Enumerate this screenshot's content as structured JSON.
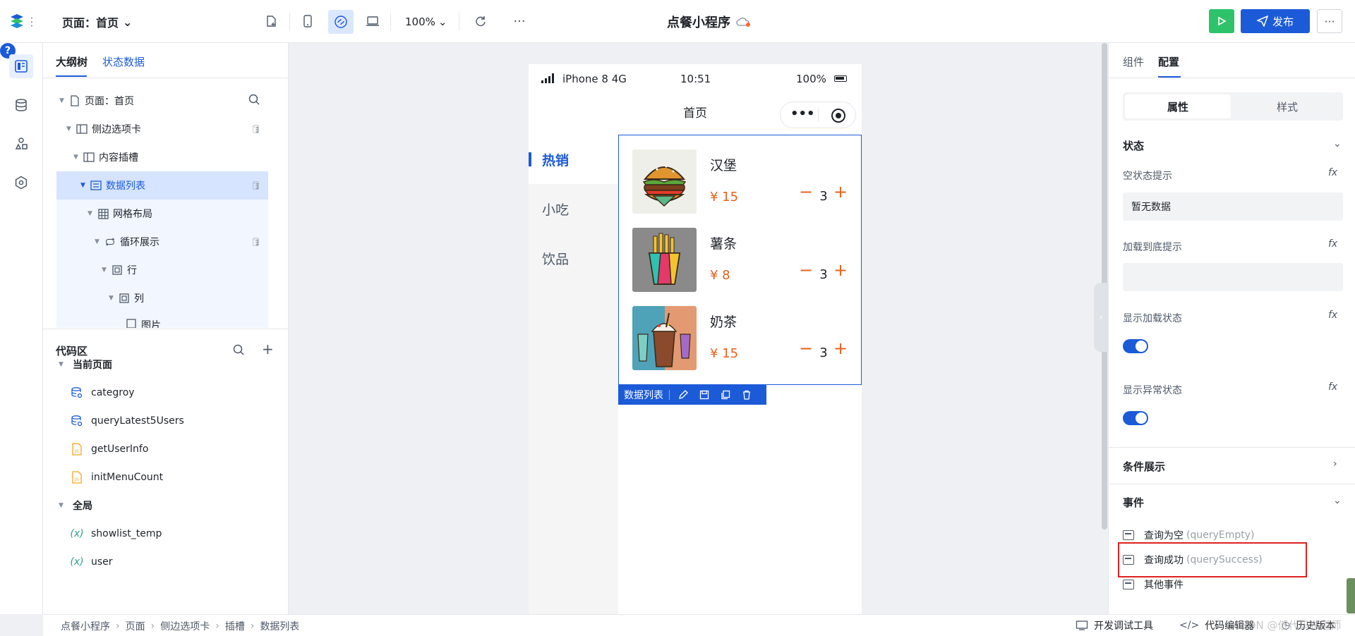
{
  "toolbar": {
    "page_select": "页面：首页",
    "zoom": "100%",
    "app_title": "点餐小程序",
    "publish_label": "发布"
  },
  "left_panel": {
    "tabs": {
      "outline": "大纲树",
      "state": "状态数据"
    },
    "tree": [
      {
        "label": "页面：首页"
      },
      {
        "label": "侧边选项卡"
      },
      {
        "label": "内容插槽"
      },
      {
        "label": "数据列表"
      },
      {
        "label": "网格布局"
      },
      {
        "label": "循环展示"
      },
      {
        "label": "行"
      },
      {
        "label": "列"
      },
      {
        "label": "图片"
      }
    ],
    "code": {
      "title": "代码区",
      "current_page_group": "当前页面",
      "items_current": [
        "categroy",
        "queryLatest5Users",
        "getUserInfo",
        "initMenuCount"
      ],
      "global_group": "全局",
      "items_global": [
        "showlist_temp",
        "user"
      ]
    }
  },
  "phone": {
    "carrier": "iPhone 8  4G",
    "time": "10:51",
    "battery": "100%",
    "nav_title": "首页",
    "tabs": [
      "热销",
      "小吃",
      "饮品"
    ],
    "items": [
      {
        "name": "汉堡",
        "price": "¥ 15",
        "qty": "3",
        "image": "burger-image"
      },
      {
        "name": "薯条",
        "price": "¥ 8",
        "qty": "3",
        "image": "fries-image"
      },
      {
        "name": "奶茶",
        "price": "¥ 15",
        "qty": "3",
        "image": "milktea-image"
      }
    ],
    "minus": "−",
    "plus": "+",
    "selection_label": "数据列表"
  },
  "right_panel": {
    "tabs": {
      "components": "组件",
      "config": "配置"
    },
    "segments": {
      "attributes": "属性",
      "style": "样式"
    },
    "state_section": "状态",
    "empty_hint_label": "空状态提示",
    "empty_hint_value": "暂无数据",
    "load_bottom_label": "加载到底提示",
    "load_bottom_value": "",
    "show_loading_label": "显示加载状态",
    "show_loading": true,
    "show_error_label": "显示异常状态",
    "show_error": true,
    "condition_section": "条件展示",
    "events_section": "事件",
    "events": [
      {
        "label": "查询为空",
        "sub": "(queryEmpty)"
      },
      {
        "label": "查询成功",
        "sub": "(querySuccess)"
      },
      {
        "label": "其他事件",
        "sub": ""
      }
    ],
    "fx": "fx"
  },
  "bottom_bar": {
    "breadcrumbs": [
      "点餐小程序",
      "页面",
      "侧边选项卡",
      "插槽",
      "数据列表"
    ],
    "dev_tools": "开发调试工具",
    "code_editor": "代码编辑器",
    "version": "历史版本"
  },
  "watermark": "CSDN @低代码布道师",
  "colors": {
    "accent": "#1c5bd8",
    "price": "#e8601c",
    "preview": "#2ec26a",
    "highlight": "#e02020"
  }
}
